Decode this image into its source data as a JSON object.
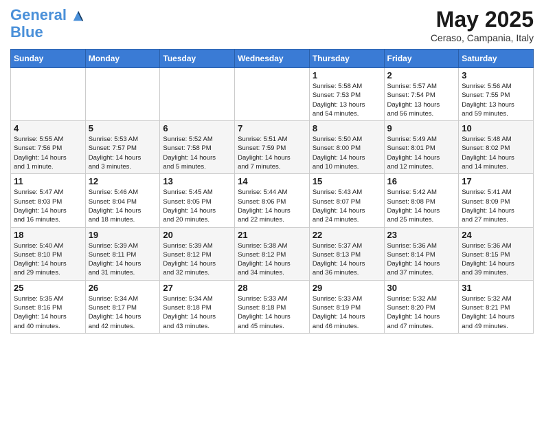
{
  "header": {
    "logo_line1": "General",
    "logo_line2": "Blue",
    "month_title": "May 2025",
    "subtitle": "Ceraso, Campania, Italy"
  },
  "days_of_week": [
    "Sunday",
    "Monday",
    "Tuesday",
    "Wednesday",
    "Thursday",
    "Friday",
    "Saturday"
  ],
  "weeks": [
    [
      {
        "day": "",
        "info": ""
      },
      {
        "day": "",
        "info": ""
      },
      {
        "day": "",
        "info": ""
      },
      {
        "day": "",
        "info": ""
      },
      {
        "day": "1",
        "info": "Sunrise: 5:58 AM\nSunset: 7:53 PM\nDaylight: 13 hours\nand 54 minutes."
      },
      {
        "day": "2",
        "info": "Sunrise: 5:57 AM\nSunset: 7:54 PM\nDaylight: 13 hours\nand 56 minutes."
      },
      {
        "day": "3",
        "info": "Sunrise: 5:56 AM\nSunset: 7:55 PM\nDaylight: 13 hours\nand 59 minutes."
      }
    ],
    [
      {
        "day": "4",
        "info": "Sunrise: 5:55 AM\nSunset: 7:56 PM\nDaylight: 14 hours\nand 1 minute."
      },
      {
        "day": "5",
        "info": "Sunrise: 5:53 AM\nSunset: 7:57 PM\nDaylight: 14 hours\nand 3 minutes."
      },
      {
        "day": "6",
        "info": "Sunrise: 5:52 AM\nSunset: 7:58 PM\nDaylight: 14 hours\nand 5 minutes."
      },
      {
        "day": "7",
        "info": "Sunrise: 5:51 AM\nSunset: 7:59 PM\nDaylight: 14 hours\nand 7 minutes."
      },
      {
        "day": "8",
        "info": "Sunrise: 5:50 AM\nSunset: 8:00 PM\nDaylight: 14 hours\nand 10 minutes."
      },
      {
        "day": "9",
        "info": "Sunrise: 5:49 AM\nSunset: 8:01 PM\nDaylight: 14 hours\nand 12 minutes."
      },
      {
        "day": "10",
        "info": "Sunrise: 5:48 AM\nSunset: 8:02 PM\nDaylight: 14 hours\nand 14 minutes."
      }
    ],
    [
      {
        "day": "11",
        "info": "Sunrise: 5:47 AM\nSunset: 8:03 PM\nDaylight: 14 hours\nand 16 minutes."
      },
      {
        "day": "12",
        "info": "Sunrise: 5:46 AM\nSunset: 8:04 PM\nDaylight: 14 hours\nand 18 minutes."
      },
      {
        "day": "13",
        "info": "Sunrise: 5:45 AM\nSunset: 8:05 PM\nDaylight: 14 hours\nand 20 minutes."
      },
      {
        "day": "14",
        "info": "Sunrise: 5:44 AM\nSunset: 8:06 PM\nDaylight: 14 hours\nand 22 minutes."
      },
      {
        "day": "15",
        "info": "Sunrise: 5:43 AM\nSunset: 8:07 PM\nDaylight: 14 hours\nand 24 minutes."
      },
      {
        "day": "16",
        "info": "Sunrise: 5:42 AM\nSunset: 8:08 PM\nDaylight: 14 hours\nand 25 minutes."
      },
      {
        "day": "17",
        "info": "Sunrise: 5:41 AM\nSunset: 8:09 PM\nDaylight: 14 hours\nand 27 minutes."
      }
    ],
    [
      {
        "day": "18",
        "info": "Sunrise: 5:40 AM\nSunset: 8:10 PM\nDaylight: 14 hours\nand 29 minutes."
      },
      {
        "day": "19",
        "info": "Sunrise: 5:39 AM\nSunset: 8:11 PM\nDaylight: 14 hours\nand 31 minutes."
      },
      {
        "day": "20",
        "info": "Sunrise: 5:39 AM\nSunset: 8:12 PM\nDaylight: 14 hours\nand 32 minutes."
      },
      {
        "day": "21",
        "info": "Sunrise: 5:38 AM\nSunset: 8:12 PM\nDaylight: 14 hours\nand 34 minutes."
      },
      {
        "day": "22",
        "info": "Sunrise: 5:37 AM\nSunset: 8:13 PM\nDaylight: 14 hours\nand 36 minutes."
      },
      {
        "day": "23",
        "info": "Sunrise: 5:36 AM\nSunset: 8:14 PM\nDaylight: 14 hours\nand 37 minutes."
      },
      {
        "day": "24",
        "info": "Sunrise: 5:36 AM\nSunset: 8:15 PM\nDaylight: 14 hours\nand 39 minutes."
      }
    ],
    [
      {
        "day": "25",
        "info": "Sunrise: 5:35 AM\nSunset: 8:16 PM\nDaylight: 14 hours\nand 40 minutes."
      },
      {
        "day": "26",
        "info": "Sunrise: 5:34 AM\nSunset: 8:17 PM\nDaylight: 14 hours\nand 42 minutes."
      },
      {
        "day": "27",
        "info": "Sunrise: 5:34 AM\nSunset: 8:18 PM\nDaylight: 14 hours\nand 43 minutes."
      },
      {
        "day": "28",
        "info": "Sunrise: 5:33 AM\nSunset: 8:18 PM\nDaylight: 14 hours\nand 45 minutes."
      },
      {
        "day": "29",
        "info": "Sunrise: 5:33 AM\nSunset: 8:19 PM\nDaylight: 14 hours\nand 46 minutes."
      },
      {
        "day": "30",
        "info": "Sunrise: 5:32 AM\nSunset: 8:20 PM\nDaylight: 14 hours\nand 47 minutes."
      },
      {
        "day": "31",
        "info": "Sunrise: 5:32 AM\nSunset: 8:21 PM\nDaylight: 14 hours\nand 49 minutes."
      }
    ]
  ]
}
